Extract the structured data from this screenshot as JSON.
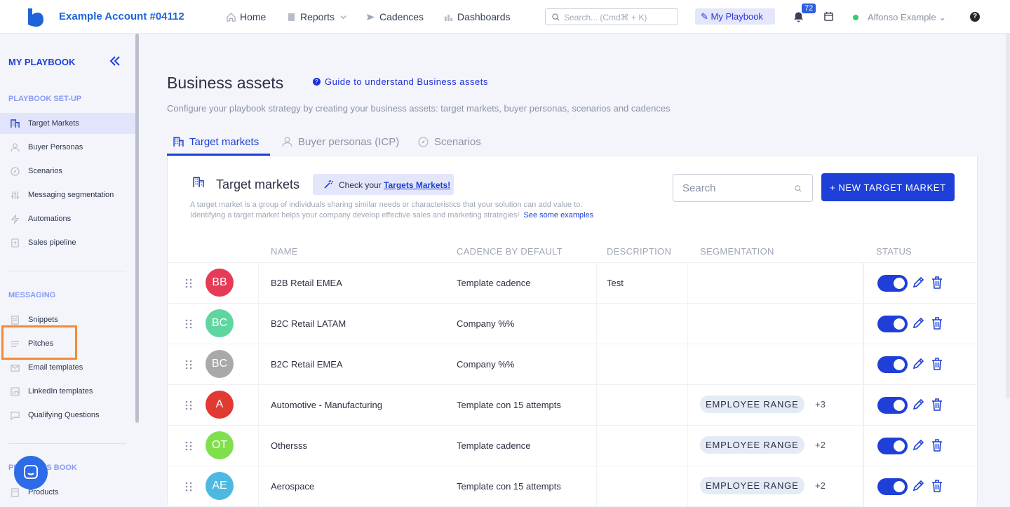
{
  "topbar": {
    "account": "Example Account #04112",
    "nav": {
      "home": "Home",
      "reports": "Reports",
      "cadences": "Cadences",
      "dashboards": "Dashboards"
    },
    "search_placeholder": "Search... (Cmd⌘ + K)",
    "my_playbook": "My Playbook",
    "notifications": "72",
    "user": "Alfonso Example",
    "help": "?"
  },
  "sidebar": {
    "title": "MY PLAYBOOK",
    "setup_label": "PLAYBOOK SET-UP",
    "setup_items": [
      {
        "label": "Target Markets",
        "icon": "building-icon"
      },
      {
        "label": "Buyer Personas",
        "icon": "persona-icon"
      },
      {
        "label": "Scenarios",
        "icon": "compass-icon"
      },
      {
        "label": "Messaging segmentation",
        "icon": "sliders-icon"
      },
      {
        "label": "Automations",
        "icon": "bolt-icon"
      },
      {
        "label": "Sales pipeline",
        "icon": "pipeline-icon"
      }
    ],
    "messaging_label": "MESSAGING",
    "messaging_items": [
      {
        "label": "Snippets",
        "icon": "snippet-icon"
      },
      {
        "label": "Pitches",
        "icon": "lines-icon"
      },
      {
        "label": "Email templates",
        "icon": "mail-icon"
      },
      {
        "label": "LinkedIn templates",
        "icon": "linkedin-icon"
      },
      {
        "label": "Qualifying Questions",
        "icon": "question-icon"
      }
    ],
    "book_label": "PRODUCTS BOOK",
    "book_items": [
      {
        "label": "Products",
        "icon": "box-icon"
      }
    ]
  },
  "page": {
    "title": "Business assets",
    "guide_link": "Guide to understand Business assets",
    "subtitle": "Configure your playbook strategy by creating your business assets: target markets, buyer personas, scenarios and cadences",
    "tabs": [
      "Target markets",
      "Buyer personas (ICP)",
      "Scenarios"
    ]
  },
  "card": {
    "title": "Target markets",
    "check_prefix": "Check your ",
    "check_link": "Targets Markets!",
    "desc_line1": "A target market is a group of individuals sharing similar needs or characteristics that your solution can add value to.",
    "desc_line2": "Identifying a target market helps your company develop effective sales and marketing strategies!",
    "desc_link": "See some examples",
    "search_placeholder": "Search",
    "new_button": "+ NEW TARGET MARKET",
    "columns": {
      "name": "NAME",
      "cadence": "CADENCE BY DEFAULT",
      "description": "DESCRIPTION",
      "segmentation": "SEGMENTATION",
      "status": "STATUS"
    },
    "rows": [
      {
        "initials": "BB",
        "color": "#e63b57",
        "name": "B2B Retail EMEA",
        "cadence": "Template cadence",
        "description": "Test",
        "segmentation": "",
        "more": "",
        "enabled": true
      },
      {
        "initials": "BC",
        "color": "#5fd6a0",
        "name": "B2C Retail LATAM",
        "cadence": "Company %%",
        "description": "",
        "segmentation": "",
        "more": "",
        "enabled": true
      },
      {
        "initials": "BC",
        "color": "#a9a9a9",
        "name": "B2C Retail EMEA",
        "cadence": "Company %%",
        "description": "",
        "segmentation": "",
        "more": "",
        "enabled": true
      },
      {
        "initials": "A",
        "color": "#e03a33",
        "name": "Automotive - Manufacturing",
        "cadence": "Template con 15 attempts",
        "description": "",
        "segmentation": "EMPLOYEE RANGE",
        "more": "+3",
        "enabled": true
      },
      {
        "initials": "OT",
        "color": "#7fe04b",
        "name": "Othersss",
        "cadence": "Template cadence",
        "description": "",
        "segmentation": "EMPLOYEE RANGE",
        "more": "+2",
        "enabled": true
      },
      {
        "initials": "AE",
        "color": "#4cb9e3",
        "name": "Aerospace",
        "cadence": "Template con 15 attempts",
        "description": "",
        "segmentation": "EMPLOYEE RANGE",
        "more": "+2",
        "enabled": true
      }
    ]
  },
  "colors": {
    "accent": "#1e3fd8",
    "highlight": "#f38a3a"
  }
}
